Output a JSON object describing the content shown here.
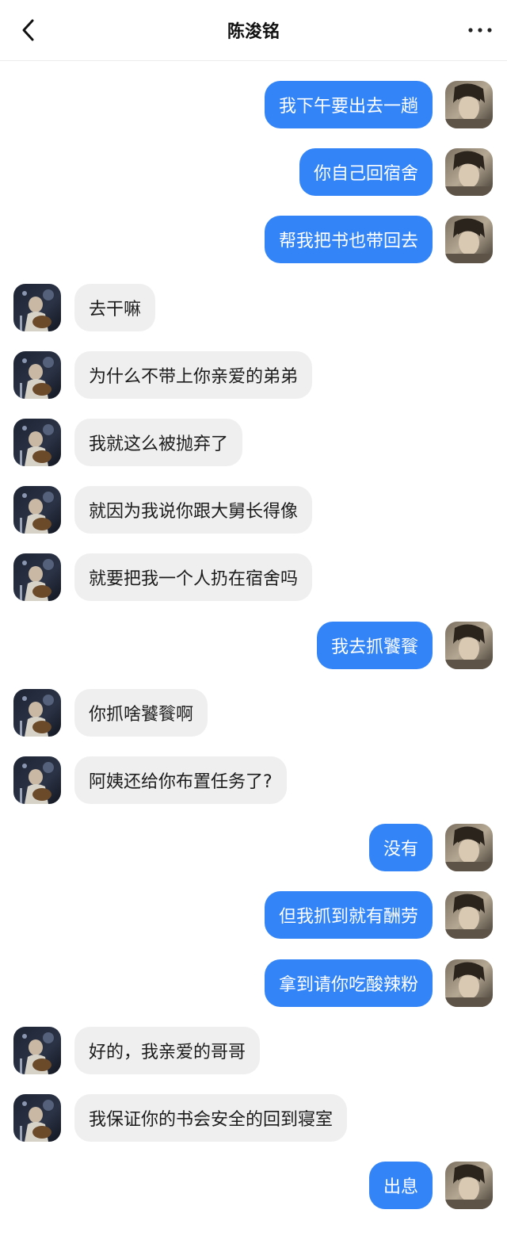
{
  "header": {
    "title": "陈浚铭",
    "back_icon": "chevron-left-icon",
    "more_icon": "more-dots-icon"
  },
  "colors": {
    "sent_bubble": "#3284f7",
    "received_bubble": "#efefef"
  },
  "messages": [
    {
      "from": "me",
      "text": "我下午要出去一趟"
    },
    {
      "from": "me",
      "text": "你自己回宿舍"
    },
    {
      "from": "me",
      "text": "帮我把书也带回去"
    },
    {
      "from": "them",
      "text": "去干嘛"
    },
    {
      "from": "them",
      "text": "为什么不带上你亲爱的弟弟"
    },
    {
      "from": "them",
      "text": "我就这么被抛弃了"
    },
    {
      "from": "them",
      "text": "就因为我说你跟大舅长得像"
    },
    {
      "from": "them",
      "text": "就要把我一个人扔在宿舍吗"
    },
    {
      "from": "me",
      "text": "我去抓饕餮"
    },
    {
      "from": "them",
      "text": "你抓啥饕餮啊"
    },
    {
      "from": "them",
      "text": "阿姨还给你布置任务了?"
    },
    {
      "from": "me",
      "text": "没有"
    },
    {
      "from": "me",
      "text": "但我抓到就有酬劳"
    },
    {
      "from": "me",
      "text": "拿到请你吃酸辣粉"
    },
    {
      "from": "them",
      "text": "好的，我亲爱的哥哥"
    },
    {
      "from": "them",
      "text": "我保证你的书会安全的回到寝室"
    },
    {
      "from": "me",
      "text": "出息"
    }
  ]
}
